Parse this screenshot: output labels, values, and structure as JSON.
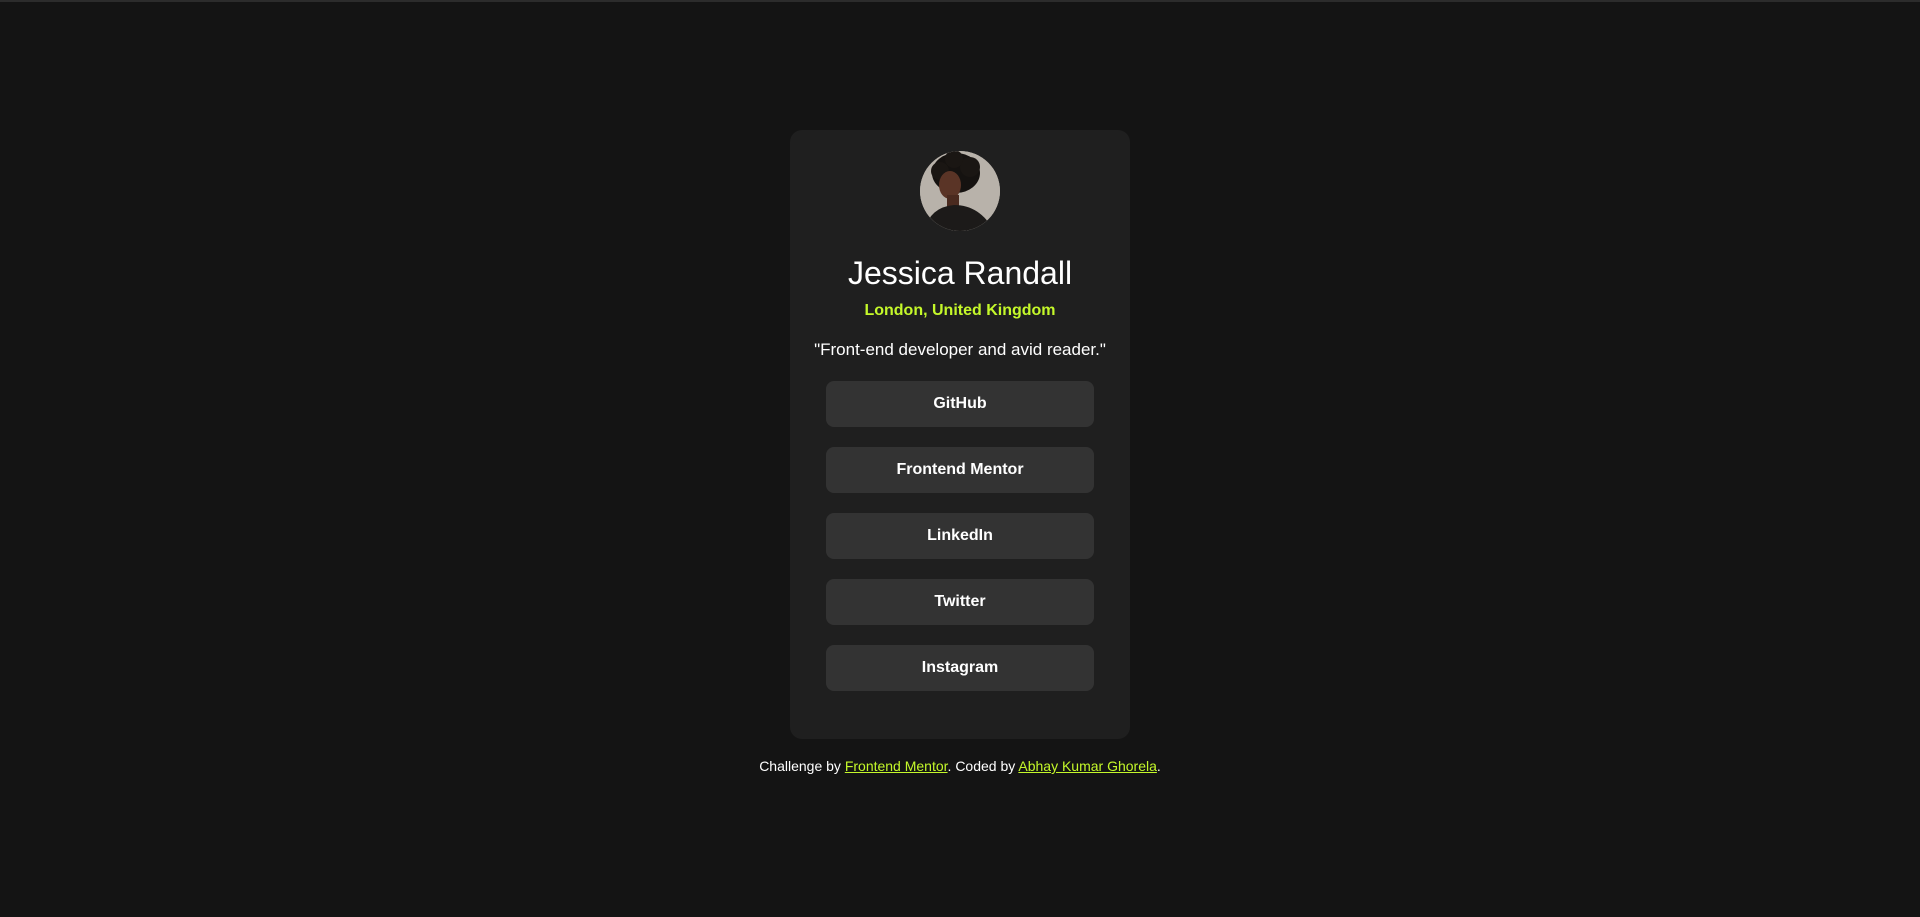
{
  "profile": {
    "name": "Jessica Randall",
    "location": "London, United Kingdom",
    "bio": "\"Front-end developer and avid reader.\""
  },
  "links": [
    {
      "label": "GitHub"
    },
    {
      "label": "Frontend Mentor"
    },
    {
      "label": "LinkedIn"
    },
    {
      "label": "Twitter"
    },
    {
      "label": "Instagram"
    }
  ],
  "footer": {
    "prefix": "Challenge by ",
    "challenge_link": "Frontend Mentor",
    "middle": ". Coded by ",
    "author_link": "Abhay Kumar Ghorela",
    "suffix": "."
  },
  "colors": {
    "background": "#141414",
    "card": "#1f1f1f",
    "button": "#333333",
    "accent": "#c4f82a",
    "text": "#ffffff"
  },
  "icons": {
    "avatar": "profile-photo"
  }
}
